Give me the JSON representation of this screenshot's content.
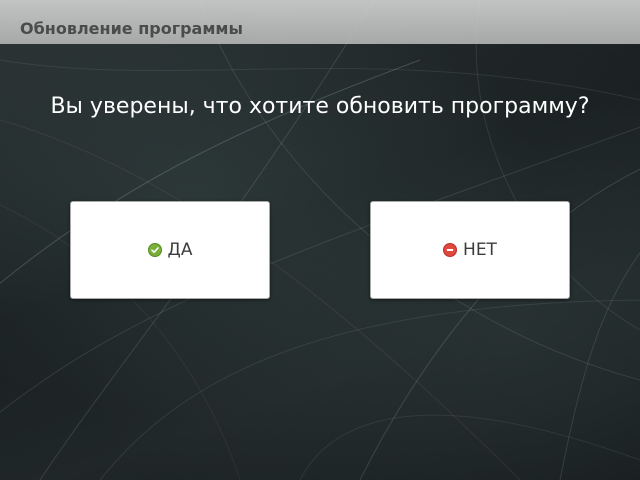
{
  "window": {
    "title": "Обновление программы"
  },
  "dialog": {
    "question": "Вы уверены, что хотите обновить программу?",
    "yes_button": {
      "label": "ДА",
      "icon": "check-circle-icon",
      "icon_color": "#7ab03a"
    },
    "no_button": {
      "label": "НЕТ",
      "icon": "minus-circle-icon",
      "icon_color": "#e0473d"
    }
  }
}
